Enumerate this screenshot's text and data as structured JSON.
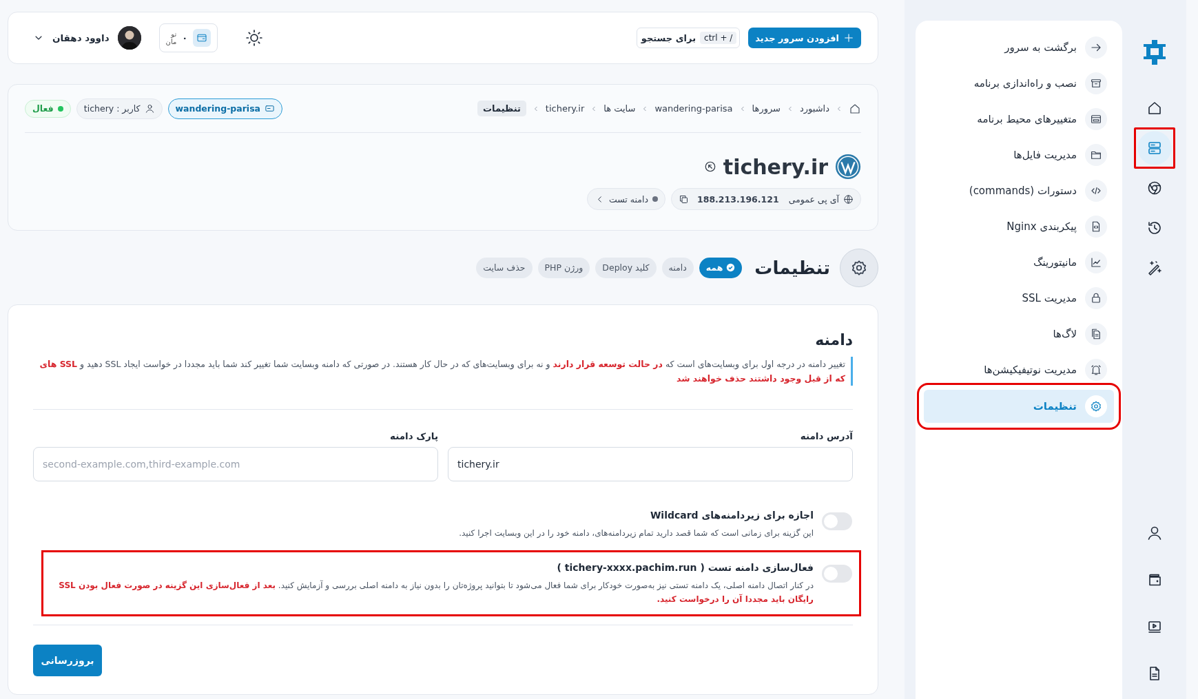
{
  "rail": {
    "top_items": [
      {
        "selected": false,
        "highlighted": false
      },
      {
        "selected": true,
        "highlighted": true
      },
      {
        "selected": false,
        "highlighted": false
      },
      {
        "selected": false,
        "highlighted": false
      },
      {
        "selected": false,
        "highlighted": false
      }
    ],
    "bottom_items": [
      {
        "selected": false,
        "highlighted": false
      },
      {
        "selected": false,
        "highlighted": false
      },
      {
        "selected": false,
        "highlighted": false
      },
      {
        "selected": false,
        "highlighted": false
      }
    ]
  },
  "sidebar": {
    "items": [
      {
        "label": "برگشت به سرور",
        "selected": false,
        "highlighted": false
      },
      {
        "label": "نصب و راه‌اندازی برنامه",
        "selected": false,
        "highlighted": false
      },
      {
        "label": "متغییرهای محیط برنامه",
        "selected": false,
        "highlighted": false
      },
      {
        "label": "مدیریت فایل‌ها",
        "selected": false,
        "highlighted": false
      },
      {
        "label": "دستورات (commands)",
        "selected": false,
        "highlighted": false
      },
      {
        "label": "پیکربندی Nginx",
        "selected": false,
        "highlighted": false
      },
      {
        "label": "مانیتورینگ",
        "selected": false,
        "highlighted": false
      },
      {
        "label": "مدیریت SSL",
        "selected": false,
        "highlighted": false
      },
      {
        "label": "لاگ‌ها",
        "selected": false,
        "highlighted": false
      },
      {
        "label": "مدیریت نوتیفیکیشن‌ها",
        "selected": false,
        "highlighted": false
      },
      {
        "label": "تنظیمات",
        "selected": true,
        "highlighted": true
      }
    ]
  },
  "top_bar": {
    "add_server_button": "افزودن سرور جدید",
    "search": {
      "shortcut": "ctrl + /",
      "label": "برای جستجو"
    },
    "wallet": {
      "amount": "۰",
      "currency": [
        "تو",
        "مان"
      ]
    },
    "user": {
      "name": "داوود دهقان"
    }
  },
  "site_header": {
    "breadcrumb": [
      {
        "label": "داشبورد",
        "selected": false
      },
      {
        "label": "سرورها",
        "selected": false
      },
      {
        "label": "wandering-parisa",
        "selected": false
      },
      {
        "label": "سایت ها",
        "selected": false
      },
      {
        "label": "tichery.ir",
        "selected": false
      },
      {
        "label": "تنظیمات",
        "selected": true
      }
    ],
    "server_chip": "wandering-parisa",
    "user_chip": "کاربر : tichery",
    "status": {
      "label": "فعال",
      "active": true
    },
    "title": "tichery.ir",
    "ip": {
      "label": "آی پی عمومی",
      "value": "188.213.196.121"
    },
    "test_domain": {
      "label": "دامنه تست",
      "active": false
    }
  },
  "settings": {
    "title": "تنظیمات",
    "tabs": [
      {
        "label": "همه",
        "selected": true
      },
      {
        "label": "دامنه",
        "selected": false
      },
      {
        "label": "کلید Deploy",
        "selected": false
      },
      {
        "label": "ورژن PHP",
        "selected": false
      },
      {
        "label": "حذف سایت",
        "selected": false
      }
    ]
  },
  "domain": {
    "title": "دامنه",
    "note": "تغییر دامنه در درجه اول برای وبسایت‌های است که **در حالت توسعه قرار دارند** و نه برای وبسایت‌های که در حال کار هستند. در صورتی که دامنه وبسایت شما تغییر کند شما باید مجددا در خواست ایجاد SSL دهید و **SSL های که از قبل وجود داشتند حذف خواهند شد**",
    "fields": [
      {
        "label": "آدرس دامنه",
        "value": "tichery.ir"
      },
      {
        "label": "پارک دامنه",
        "placeholder": "second-example.com,third-example.com"
      }
    ],
    "options": [
      {
        "title": "اجازه برای زیردامنه‌های Wildcard",
        "description": "این گزینه برای زمانی است که شما قصد دارید تمام زیردامنه‌های، دامنه خود را در این وبسایت اجرا کنید.",
        "on": false,
        "highlighted": false
      },
      {
        "title": "فعال‌سازی دامنه تست ( tichery-xxxx.pachim.run )",
        "description": "در کنار اتصال دامنه اصلی، یک دامنه تستی نیز به‌صورت خودکار برای شما فعال می‌شود تا بتوانید پروژه‌تان را بدون نیاز به دامنه اصلی بررسی و آزمایش کنید. **بعد از فعال‌سازی این گزینه در صورت فعال بودن SSL رایگان باید مجددا آن را درخواست کنید.**",
        "on": false,
        "highlighted": true
      }
    ],
    "submit_button": "بروزرسانی"
  }
}
